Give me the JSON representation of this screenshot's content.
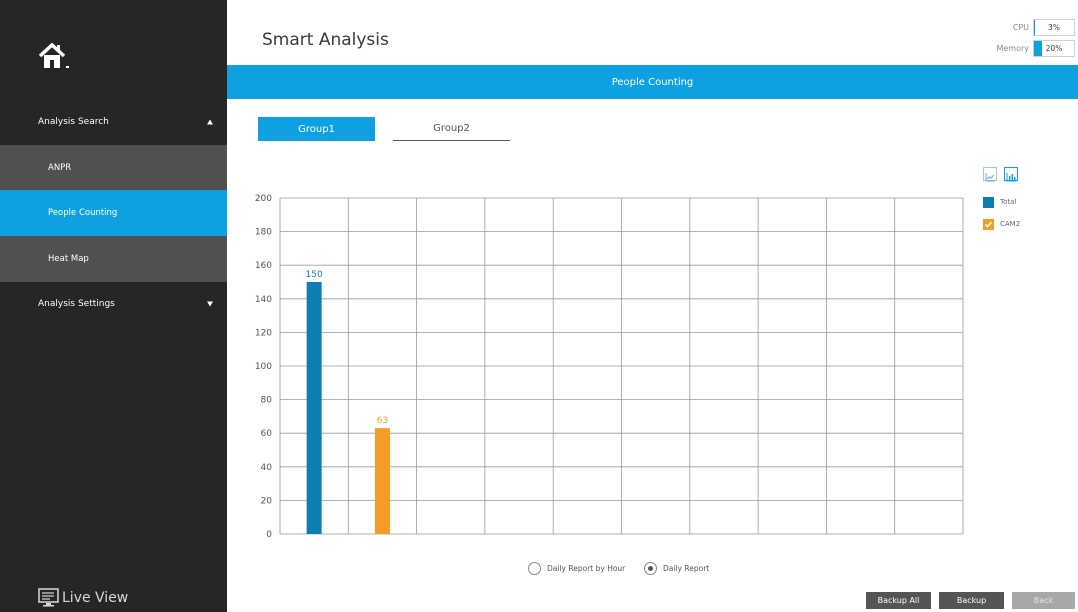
{
  "header": {
    "title": "Smart Analysis",
    "cpu": {
      "label": "CPU",
      "value": "3%",
      "percent": 3
    },
    "memory": {
      "label": "Memory",
      "value": "20%",
      "percent": 20
    }
  },
  "banner": {
    "title": "People Counting"
  },
  "sidebar": {
    "sections": [
      {
        "label": "Analysis Search",
        "expanded": true
      },
      {
        "label": "Analysis Settings",
        "expanded": false
      }
    ],
    "items": [
      {
        "label": "ANPR"
      },
      {
        "label": "People Counting",
        "active": true
      },
      {
        "label": "Heat Map"
      }
    ],
    "footer": {
      "label": "Live View"
    }
  },
  "tabs": [
    {
      "label": "Group1",
      "active": true
    },
    {
      "label": "Group2",
      "active": false
    }
  ],
  "chart_type_icons": [
    "line-chart-icon",
    "bar-chart-icon"
  ],
  "legend": [
    {
      "label": "Total",
      "color": "#0b7fb4",
      "checked": false
    },
    {
      "label": "CAM2",
      "color": "#f39c26",
      "checked": true
    }
  ],
  "chart_data": {
    "type": "bar",
    "ylim": [
      0,
      200
    ],
    "yticks": [
      "0",
      "20",
      "40",
      "60",
      "80",
      "100",
      "120",
      "140",
      "160",
      "180",
      "200"
    ],
    "series": [
      {
        "name": "Total",
        "value": 150,
        "label": "150",
        "color": "#0b7fb4"
      },
      {
        "name": "CAM2",
        "value": 63,
        "label": "63",
        "color": "#f39c26"
      }
    ],
    "grid": true
  },
  "report": {
    "options": [
      {
        "label": "Daily Report by Hour",
        "selected": false
      },
      {
        "label": "Daily Report",
        "selected": true
      }
    ]
  },
  "buttons": {
    "backup_all": "Backup All",
    "backup": "Backup",
    "back": "Back"
  },
  "colors": {
    "accent": "#0ea0e0",
    "sidebar": "#262626",
    "sidebar_item": "#505050"
  }
}
